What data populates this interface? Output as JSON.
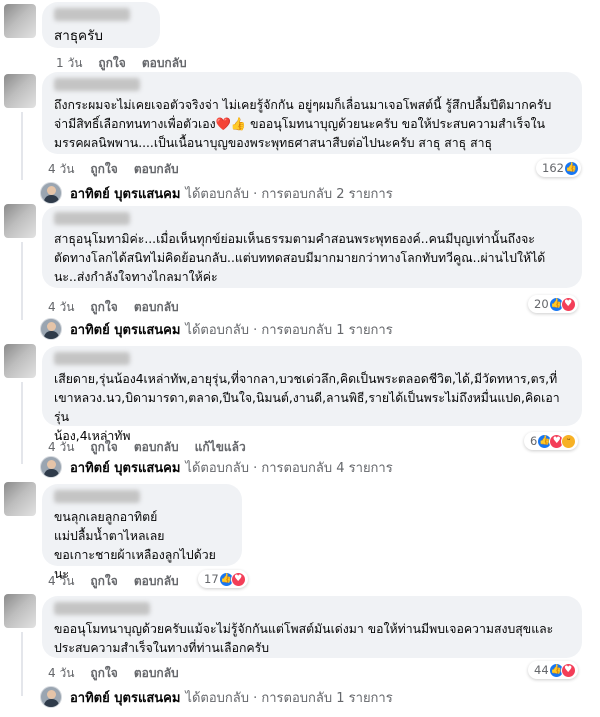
{
  "comments": [
    {
      "text": "สาธุครับ",
      "time": "1 วัน",
      "like": "ถูกใจ",
      "reply": "ตอบกลับ"
    },
    {
      "text": "ถึงกระผมจะไม่เคยเจอตัวจริงจ่า  ไม่เคยรู้จักกัน  อยู่ๆผมก็เลื่อนมาเจอโพสต์นี้ รู้สึกปลื้มปีติมากครับ\nจ่ามีสิทธิ์เลือกทนทางเพื่อตัวเอง❤️👍 ขออนุโมทนาบุญด้วยนะครับ ขอให้ประสบความสำเร็จใน\nมรรคผลนิพพาน....เป็นเนื้อนาบุญของพระพุทธศาสนาสืบต่อไปนะครับ สาธุ สาธุ สาธุ",
      "time": "4 วัน",
      "like": "ถูกใจ",
      "reply": "ตอบกลับ",
      "reaction_count": "162",
      "reply_author": "อาทิตย์ บุตรแสนคม",
      "reply_meta": "ได้ตอบกลับ · การตอบกลับ 2 รายการ"
    },
    {
      "text": "สาธุอนุโมทามิค่ะ...เมื่อเห็นทุกข์ย่อมเห็นธรรมตามคำสอนพระพุทธองค์..คนมีบุญเท่านั้นถึงจะ\nตัดทางโลกได้สนิทไม่คิดย้อนกลับ..แต่บททดสอบมีมากมายกว่าทางโลกทับทวีคูณ..ผ่านไปให้ได้\nนะ..ส่งกำลังใจทางไกลมาให้ค่ะ",
      "time": "4 วัน",
      "like": "ถูกใจ",
      "reply": "ตอบกลับ",
      "reaction_count": "20",
      "reply_author": "อาทิตย์ บุตรแสนคม",
      "reply_meta": "ได้ตอบกลับ · การตอบกลับ 1 รายการ"
    },
    {
      "text": "เสียดาย,รุ่นน้อง4เหล่าทัพ,อายุรุ่น,ที่จากลา,บวชเด่วลึก,คิดเป็นพระตลอดชีวิต,ได้,มีวัดทหาร,ตร,ที่\nเขาหลวง.นว,บิดามารดา,ตลาด,ปีนใจ,นิมนต์,งานดี,ลานพิธี,รายได้เป็นพระไม่ถึงหมื่นแปด,คิดเอารุ่น\nน้อง,4เหล่าทัพ",
      "time": "4 วัน",
      "like": "ถูกใจ",
      "reply": "ตอบกลับ",
      "edited": "แก้ไขแล้ว",
      "reaction_count": "6",
      "reply_author": "อาทิตย์ บุตรแสนคม",
      "reply_meta": "ได้ตอบกลับ · การตอบกลับ 4 รายการ"
    },
    {
      "text": "ขนลุกเลยลูกอาทิตย์\nแม่ปลื้มน้ำตาไหลเลย\nขอเกาะชายผ้าเหลืองลูกไปด้วยนะ",
      "time": "4 วัน",
      "like": "ถูกใจ",
      "reply": "ตอบกลับ",
      "reaction_count": "17"
    },
    {
      "text": "ขออนุโมทนาบุญด้วยครับแม้จะไม่รู้จักกันแต่โพสต์มันเด่งมา ขอให้ท่านมีพบเจอความสงบสุขและ\nประสบความสำเร็จในทางที่ท่านเลือกครับ",
      "time": "4 วัน",
      "like": "ถูกใจ",
      "reply": "ตอบกลับ",
      "reaction_count": "44",
      "reply_author": "อาทิตย์ บุตรแสนคม",
      "reply_meta": "ได้ตอบกลับ · การตอบกลับ 1 รายการ"
    }
  ],
  "colors": {
    "like": "#1877f2",
    "love": "#f33e58",
    "haha": "#f7b125",
    "bubble": "#f0f2f5",
    "meta": "#65676b"
  },
  "icons": {
    "like": "like-icon",
    "love": "love-icon",
    "haha": "haha-icon"
  }
}
